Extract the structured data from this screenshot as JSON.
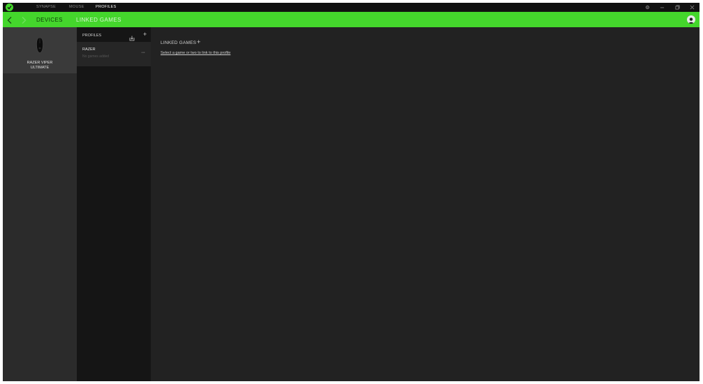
{
  "titlebar": {
    "tabs": [
      {
        "label": "SYNAPSE"
      },
      {
        "label": "MOUSE"
      },
      {
        "label": "PROFILES"
      }
    ],
    "controls": [
      "gear-icon",
      "minimize-icon",
      "restore-icon",
      "close-icon"
    ]
  },
  "navbar": {
    "tabs": [
      {
        "label": "DEVICES"
      },
      {
        "label": "LINKED GAMES"
      }
    ]
  },
  "devices": {
    "items": [
      {
        "name_line1": "RAZER VIPER",
        "name_line2": "ULTIMATE"
      }
    ]
  },
  "profiles": {
    "title": "PROFILES",
    "add_label": "+",
    "items": [
      {
        "name": "RAZER",
        "subtitle": "No games added",
        "more_label": "···"
      }
    ]
  },
  "linked_games": {
    "title": "LINKED GAMES",
    "add_label": "+",
    "hint": "Select a game or two to link to this profile"
  },
  "colors": {
    "accent": "#44d62c",
    "titlebar_bg": "#111111",
    "content_bg": "#222222"
  }
}
